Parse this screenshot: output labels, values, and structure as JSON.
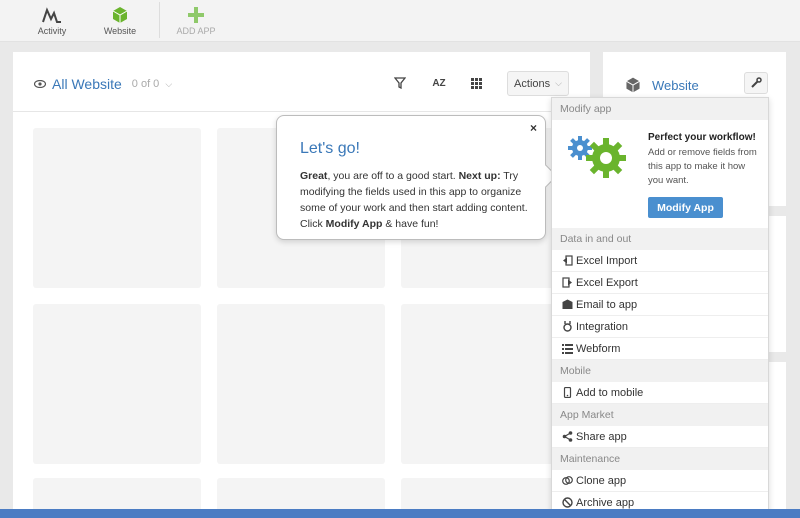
{
  "nav": {
    "activity": "Activity",
    "website": "Website",
    "add_app": "ADD APP"
  },
  "panel": {
    "title": "All Website",
    "count": "0 of 0",
    "sort_label": "AZ",
    "actions_label": "Actions"
  },
  "sidebar": {
    "title": "Website"
  },
  "popover": {
    "title": "Let's go!",
    "great": "Great",
    "text1": ", you are off to a good start. ",
    "next_up": "Next up:",
    "text2": " Try modifying the fields used in this app to organize some of your work and then start adding content. Click ",
    "modify_app": "Modify App",
    "text3": " & have fun!",
    "close": "×"
  },
  "dropdown": {
    "modify_section": "Modify app",
    "promo_title": "Perfect your workflow!",
    "promo_text": "Add or remove fields from this app to make it how you want.",
    "promo_button": "Modify App",
    "data_section": "Data in and out",
    "excel_import": "Excel Import",
    "excel_export": "Excel Export",
    "email_to_app": "Email to app",
    "integration": "Integration",
    "webform": "Webform",
    "mobile_section": "Mobile",
    "add_to_mobile": "Add to mobile",
    "market_section": "App Market",
    "share_app": "Share app",
    "maintenance_section": "Maintenance",
    "clone_app": "Clone app",
    "archive_app": "Archive app"
  },
  "colors": {
    "accent": "#3a78b8",
    "button": "#4a8fcf",
    "green": "#6ab42d"
  }
}
